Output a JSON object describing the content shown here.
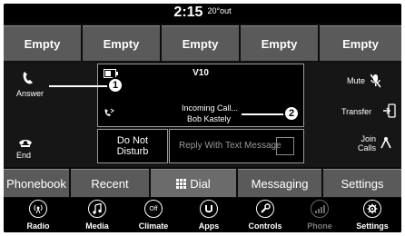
{
  "status": {
    "time": "2:15",
    "outside_temp": "20°out"
  },
  "favorites": [
    "Empty",
    "Empty",
    "Empty",
    "Empty",
    "Empty"
  ],
  "call": {
    "answer_label": "Answer",
    "end_label": "End",
    "mute_label": "Mute",
    "transfer_label": "Transfer",
    "join_calls_label": "Join Calls",
    "device_name": "V10",
    "incoming_label": "Incoming Call...",
    "caller_name": "Bob Kastely",
    "do_not_disturb_line1": "Do Not",
    "do_not_disturb_line2": "Disturb",
    "reply_label": "Reply With Text Message"
  },
  "tabs": [
    "Phonebook",
    "Recent",
    "Dial",
    "Messaging",
    "Settings"
  ],
  "apps": [
    {
      "label": "Radio",
      "icon": "radio-icon"
    },
    {
      "label": "Media",
      "icon": "music-note-icon"
    },
    {
      "label": "Climate",
      "icon": "climate-off-icon",
      "glyph": "Off"
    },
    {
      "label": "Apps",
      "icon": "apps-icon"
    },
    {
      "label": "Controls",
      "icon": "wrench-icon"
    },
    {
      "label": "Phone",
      "icon": "phone-signal-icon"
    },
    {
      "label": "Settings",
      "icon": "gear-icon"
    }
  ],
  "callouts": [
    "1",
    "2"
  ]
}
